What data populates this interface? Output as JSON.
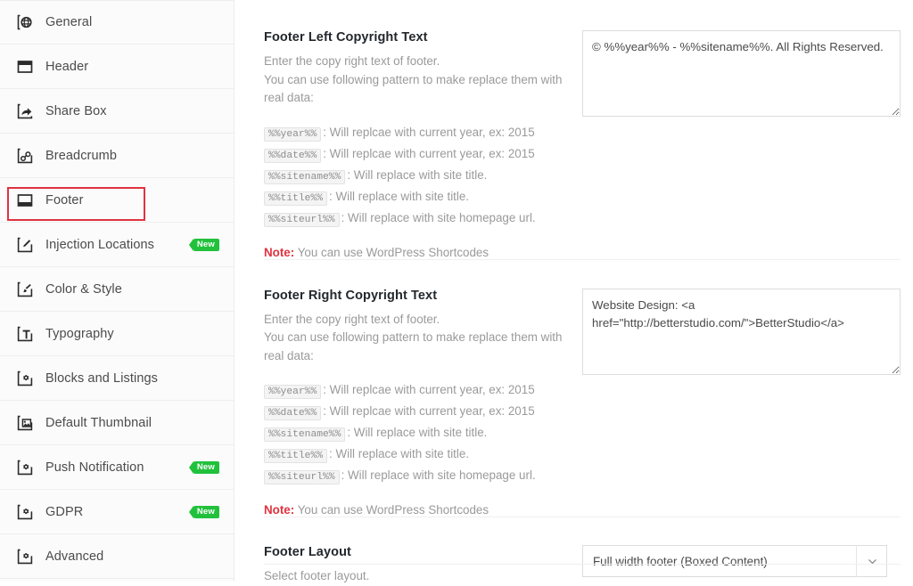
{
  "sidebar": {
    "items": [
      {
        "label": "General",
        "icon": "globe-icon",
        "badge": ""
      },
      {
        "label": "Header",
        "icon": "header-icon",
        "badge": ""
      },
      {
        "label": "Share Box",
        "icon": "share-icon",
        "badge": ""
      },
      {
        "label": "Breadcrumb",
        "icon": "link-icon",
        "badge": ""
      },
      {
        "label": "Footer",
        "icon": "footer-icon",
        "badge": ""
      },
      {
        "label": "Injection Locations",
        "icon": "pencil-icon",
        "badge": "New"
      },
      {
        "label": "Color & Style",
        "icon": "brush-icon",
        "badge": ""
      },
      {
        "label": "Typography",
        "icon": "text-icon",
        "badge": ""
      },
      {
        "label": "Blocks and Listings",
        "icon": "gear-icon",
        "badge": ""
      },
      {
        "label": "Default Thumbnail",
        "icon": "image-icon",
        "badge": ""
      },
      {
        "label": "Push Notification",
        "icon": "gear-icon",
        "badge": "New"
      },
      {
        "label": "GDPR",
        "icon": "gear-icon",
        "badge": "New"
      },
      {
        "label": "Advanced",
        "icon": "gear-icon",
        "badge": ""
      }
    ],
    "selected": "Footer",
    "highlight_color": "#e0333f"
  },
  "content": {
    "fields": [
      {
        "title": "Footer Left Copyright Text",
        "desc_line1": "Enter the copy right text of footer.",
        "desc_line2": "You can use following pattern to make replace them with real data:",
        "tokens": [
          {
            "code": "%%year%%",
            "text": ": Will replcae with current year, ex: 2015"
          },
          {
            "code": "%%date%%",
            "text": ": Will replcae with current year, ex: 2015"
          },
          {
            "code": "%%sitename%%",
            "text": ": Will replace with site title."
          },
          {
            "code": "%%title%%",
            "text": ": Will replace with site title."
          },
          {
            "code": "%%siteurl%%",
            "text": ": Will replace with site homepage url."
          }
        ],
        "note_label": "Note:",
        "note_text": " You can use WordPress Shortcodes",
        "textarea_value": "© %%year%% - %%sitename%%. All Rights Reserved.",
        "textarea_placeholder": ""
      },
      {
        "title": "Footer Right Copyright Text",
        "desc_line1": "Enter the copy right text of footer.",
        "desc_line2": "You can use following pattern to make replace them with real data:",
        "tokens": [
          {
            "code": "%%year%%",
            "text": ": Will replcae with current year, ex: 2015"
          },
          {
            "code": "%%date%%",
            "text": ": Will replcae with current year, ex: 2015"
          },
          {
            "code": "%%sitename%%",
            "text": ": Will replace with site title."
          },
          {
            "code": "%%title%%",
            "text": ": Will replace with site title."
          },
          {
            "code": "%%siteurl%%",
            "text": ": Will replace with site homepage url."
          }
        ],
        "note_label": "Note:",
        "note_text": " You can use WordPress Shortcodes",
        "textarea_value": "Website Design: <a href=\"http://betterstudio.com/\">BetterStudio</a>",
        "textarea_placeholder": ""
      }
    ],
    "layout_field": {
      "title": "Footer Layout",
      "desc": "Select footer layout.",
      "selected": "Full width footer (Boxed Content)",
      "options": [
        "Full width footer (Boxed Content)"
      ]
    }
  }
}
